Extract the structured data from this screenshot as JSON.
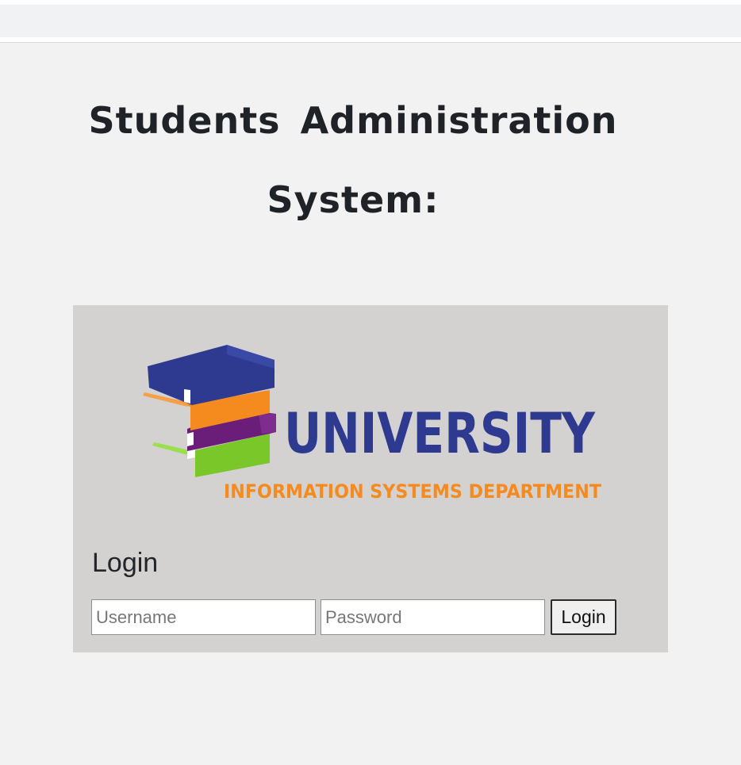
{
  "page": {
    "title": "Students Administration System:"
  },
  "logo": {
    "word": "UNIVERSITY",
    "subtitle": "INFORMATION SYSTEMS DEPARTMENT",
    "colors": {
      "blue": "#2e3a8f",
      "orange": "#f58a1f",
      "purple": "#6b1d7a",
      "green": "#7ac72a"
    }
  },
  "login": {
    "heading": "Login",
    "username_placeholder": "Username",
    "password_placeholder": "Password",
    "button_label": "Login"
  }
}
